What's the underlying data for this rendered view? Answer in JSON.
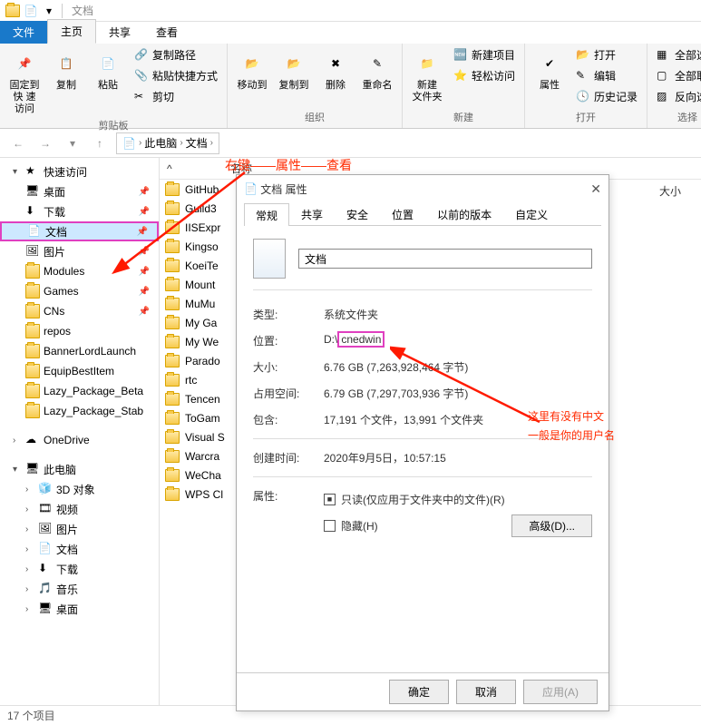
{
  "window_title": "文档",
  "ribbon_tabs": {
    "file": "文件",
    "home": "主页",
    "share": "共享",
    "view": "查看"
  },
  "ribbon": {
    "pin": "固定到快\n速访问",
    "copy": "复制",
    "paste": "粘贴",
    "copy_path": "复制路径",
    "paste_shortcut": "粘贴快捷方式",
    "cut": "剪切",
    "group_clipboard": "剪贴板",
    "move_to": "移动到",
    "copy_to": "复制到",
    "delete": "删除",
    "rename": "重命名",
    "group_organize": "组织",
    "new_folder": "新建\n文件夹",
    "new_item": "新建项目",
    "easy_access": "轻松访问",
    "group_new": "新建",
    "properties": "属性",
    "open": "打开",
    "edit": "编辑",
    "history": "历史记录",
    "group_open": "打开",
    "select_all": "全部选择",
    "select_none": "全部取消",
    "invert": "反向选择",
    "group_select": "选择"
  },
  "breadcrumb": {
    "pc": "此电脑",
    "docs": "文档"
  },
  "columns": {
    "name": "名称",
    "size": "大小"
  },
  "tree": {
    "quick": "快速访问",
    "desktop": "桌面",
    "downloads": "下载",
    "documents": "文档",
    "pictures": "图片",
    "modules": "Modules",
    "games": "Games",
    "cns": "CNs",
    "repos": "repos",
    "banner": "BannerLordLaunch",
    "equip": "EquipBestItem",
    "lazy_beta": "Lazy_Package_Beta",
    "lazy_stab": "Lazy_Package_Stab",
    "onedrive": "OneDrive",
    "thispc": "此电脑",
    "objects3d": "3D 对象",
    "videos": "视频",
    "pictures2": "图片",
    "documents2": "文档",
    "downloads2": "下载",
    "music": "音乐",
    "desktop2": "桌面"
  },
  "files": {
    "f0": "GitHub",
    "f1": "Guild3",
    "f2": "IISExpr",
    "f3": "Kingso",
    "f4": "KoeiTe",
    "f5": "Mount",
    "f6": "MuMu",
    "f7": "My Ga",
    "f8": "My We",
    "f9": "Parado",
    "f10": "rtc",
    "f11": "Tencen",
    "f12": "ToGam",
    "f13": "Visual S",
    "f14": "Warcra",
    "f15": "WeCha",
    "f16": "WPS Cl"
  },
  "status_text": "17 个项目",
  "props": {
    "title": "文档 属性",
    "tabs": {
      "general": "常规",
      "share": "共享",
      "security": "安全",
      "location": "位置",
      "prev": "以前的版本",
      "custom": "自定义"
    },
    "name_value": "文档",
    "k_type": "类型:",
    "v_type": "系统文件夹",
    "k_loc": "位置:",
    "v_loc_pre": "D:\\",
    "v_loc_hl": "cnedwin",
    "k_size": "大小:",
    "v_size": "6.76 GB (7,263,928,464 字节)",
    "k_disk": "占用空间:",
    "v_disk": "6.79 GB (7,297,703,936 字节)",
    "k_contains": "包含:",
    "v_contains": "17,191 个文件，13,991 个文件夹",
    "k_created": "创建时间:",
    "v_created": "2020年9月5日，10:57:15",
    "k_attr": "属性:",
    "readonly_label": "只读(仅应用于文件夹中的文件)(R)",
    "hidden_label": "隐藏(H)",
    "advanced": "高级(D)...",
    "ok": "确定",
    "cancel": "取消",
    "apply": "应用(A)"
  },
  "annotations": {
    "a1": "右键——属性——查看",
    "a2_l1": "这里有没有中文",
    "a2_l2": "一般是你的用户名"
  }
}
